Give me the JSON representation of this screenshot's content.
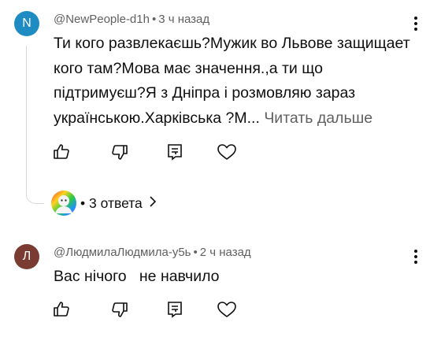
{
  "comments": [
    {
      "avatar_letter": "N",
      "avatar_color": "#1e8bc3",
      "author": "@NewPeople-d1h",
      "time": "3 ч назад",
      "text": "Ти кого развлекаєшь?Мужик во Львове защищает кого там?Мова має значення.,а ти що підтримуєш?Я з Дніпра і розмовляю зараз українською.Харківська ?М...",
      "read_more": "Читать дальше",
      "replies_label": "3 ответа"
    },
    {
      "avatar_letter": "Л",
      "avatar_color": "#7a3b32",
      "author": "@ЛюдмилаЛюдмила-у5ь",
      "time": "2 ч назад",
      "text": "Вас нічого   не навчило"
    }
  ],
  "separator": "•",
  "icons": [
    "like-icon",
    "dislike-icon",
    "reply-icon",
    "heart-icon",
    "more-vert-icon",
    "chevron-right-icon"
  ]
}
